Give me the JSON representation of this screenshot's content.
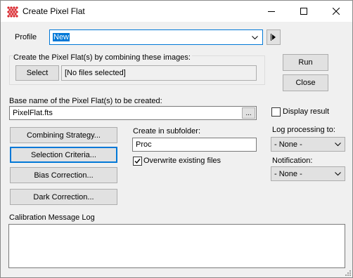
{
  "window": {
    "title": "Create Pixel Flat",
    "controls": [
      "minimize-icon",
      "maximize-icon",
      "close-icon"
    ]
  },
  "profile": {
    "label": "Profile",
    "value": "New",
    "play_icon": "play-icon"
  },
  "images_group": {
    "label": "Create the Pixel Flat(s) by combining these images:",
    "select_label": "Select",
    "files_value": "[No files selected]"
  },
  "actions": {
    "run_label": "Run",
    "close_label": "Close"
  },
  "basename": {
    "label": "Base name of the Pixel Flat(s) to be created:",
    "value": "PixelFlat.fts",
    "browse_label": "..."
  },
  "display_result": {
    "label": "Display result",
    "checked": false
  },
  "buttons": {
    "combining": "Combining Strategy...",
    "selection": "Selection Criteria...",
    "bias": "Bias Correction...",
    "dark": "Dark Correction..."
  },
  "subfolder": {
    "label": "Create in subfolder:",
    "value": "Proc"
  },
  "overwrite": {
    "label": "Overwrite existing files",
    "checked": true
  },
  "log_processing": {
    "label": "Log processing to:",
    "value": "- None -"
  },
  "notification": {
    "label": "Notification:",
    "value": "- None -"
  },
  "message_log": {
    "label": "Calibration Message Log",
    "value": ""
  },
  "colors": {
    "accent": "#0078d7",
    "background": "#f0f0f0",
    "icon_red": "#d9262c"
  }
}
